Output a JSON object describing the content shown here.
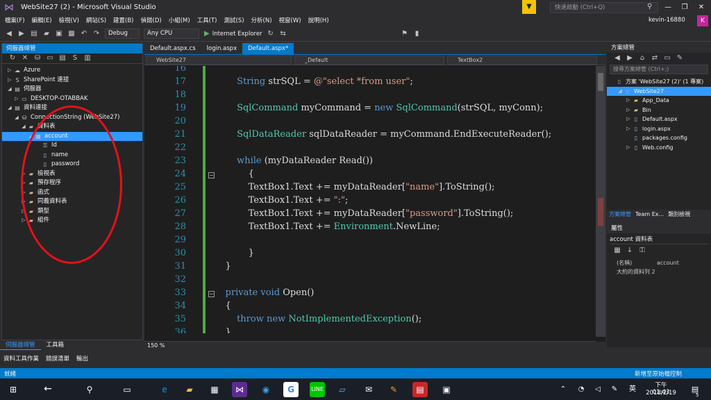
{
  "window": {
    "title": "WebSite27 (2) - Microsoft Visual Studio",
    "quick_launch": "快速啟動 (Ctrl+Q)",
    "user": "kevin-16880",
    "user_initial": "K"
  },
  "menu": [
    "檔案(F)",
    "編輯(E)",
    "檢視(V)",
    "網站(S)",
    "建置(B)",
    "偵錯(D)",
    "小組(M)",
    "工具(T)",
    "測試(S)",
    "分析(N)",
    "視窗(W)",
    "說明(H)"
  ],
  "toolbar": {
    "config": "Debug",
    "platform": "Any CPU",
    "run": "Internet Explorer"
  },
  "server_explorer": {
    "title": "伺服器總管",
    "items": [
      {
        "label": "Azure",
        "indent": 1,
        "arrow": "▷",
        "icon": "☁"
      },
      {
        "label": "SharePoint 連接",
        "indent": 1,
        "arrow": "▷",
        "icon": "S"
      },
      {
        "label": "伺服器",
        "indent": 1,
        "arrow": "◢",
        "icon": "▤"
      },
      {
        "label": "DESKTOP-OTABBAK",
        "indent": 2,
        "arrow": "▷",
        "icon": "▭"
      },
      {
        "label": "資料連接",
        "indent": 1,
        "arrow": "◢",
        "icon": "▤"
      },
      {
        "label": "ConnectionString (WebSite27)",
        "indent": 2,
        "arrow": "◢",
        "icon": "⛁"
      },
      {
        "label": "資料表",
        "indent": 3,
        "arrow": "◢",
        "icon": "▰"
      },
      {
        "label": "account",
        "indent": 4,
        "arrow": "◢",
        "icon": "▦",
        "selected": true
      },
      {
        "label": "Id",
        "indent": 5,
        "arrow": "",
        "icon": "⚿"
      },
      {
        "label": "name",
        "indent": 5,
        "arrow": "",
        "icon": "▯"
      },
      {
        "label": "password",
        "indent": 5,
        "arrow": "",
        "icon": "▯"
      },
      {
        "label": "檢視表",
        "indent": 3,
        "arrow": "▷",
        "icon": "▰"
      },
      {
        "label": "預存程序",
        "indent": 3,
        "arrow": "▷",
        "icon": "▰"
      },
      {
        "label": "函式",
        "indent": 3,
        "arrow": "▷",
        "icon": "▰"
      },
      {
        "label": "同義資料表",
        "indent": 3,
        "arrow": "▷",
        "icon": "▰"
      },
      {
        "label": "類型",
        "indent": 3,
        "arrow": "▷",
        "icon": "▰"
      },
      {
        "label": "組件",
        "indent": 3,
        "arrow": "▷",
        "icon": "▰"
      }
    ],
    "tab_a": "伺服器總管",
    "tab_b": "工具箱"
  },
  "bottom_tabs": [
    "資料工具作業",
    "錯誤清單",
    "輸出"
  ],
  "editor": {
    "tabs": [
      "Default.aspx.cs",
      "login.aspx",
      "Default.aspx*"
    ],
    "nav": [
      "WebSite27",
      "_Default",
      "TextBox2"
    ],
    "zoom": "150 %",
    "lines": [
      {
        "n": "16",
        "code": ""
      },
      {
        "n": "17",
        "code": "        String strSQL = @\"select *from user\";"
      },
      {
        "n": "18",
        "code": ""
      },
      {
        "n": "19",
        "code": "        SqlCommand myCommand = new SqlCommand(strSQL, myConn);"
      },
      {
        "n": "20",
        "code": ""
      },
      {
        "n": "21",
        "code": "        SqlDataReader sqlDataReader = myCommand.EndExecuteReader();"
      },
      {
        "n": "22",
        "code": ""
      },
      {
        "n": "23",
        "code": "        while (myDataReader Read())"
      },
      {
        "n": "24",
        "code": "            {"
      },
      {
        "n": "25",
        "code": "            TextBox1.Text += myDataReader[\"name\"].ToString();"
      },
      {
        "n": "26",
        "code": "            TextBox1.Text += \":\";"
      },
      {
        "n": "27",
        "code": "            TextBox1.Text += myDataReader[\"password\"].ToString();"
      },
      {
        "n": "28",
        "code": "            TextBox1.Text += Environment.NewLine;"
      },
      {
        "n": "29",
        "code": ""
      },
      {
        "n": "30",
        "code": "            }"
      },
      {
        "n": "31",
        "code": "    }"
      },
      {
        "n": "32",
        "code": ""
      },
      {
        "n": "33",
        "code": "    private void Open()"
      },
      {
        "n": "34",
        "code": "    {"
      },
      {
        "n": "35",
        "code": "        throw new NotImplementedException();"
      },
      {
        "n": "36",
        "code": "    }"
      }
    ]
  },
  "solution": {
    "title": "方案總管",
    "search": "搜尋方案總管 (Ctrl+;)",
    "items": [
      {
        "label": "方案 'WebSite27 (2)' (1 專案)",
        "indent": 0,
        "arrow": ""
      },
      {
        "label": "WebSite27",
        "indent": 1,
        "arrow": "◢",
        "selected": true
      },
      {
        "label": "App_Data",
        "indent": 2,
        "arrow": "▷"
      },
      {
        "label": "Bin",
        "indent": 2,
        "arrow": "▷"
      },
      {
        "label": "Default.aspx",
        "indent": 2,
        "arrow": "▷"
      },
      {
        "label": "login.aspx",
        "indent": 2,
        "arrow": "▷"
      },
      {
        "label": "packages.config",
        "indent": 2,
        "arrow": ""
      },
      {
        "label": "Web.config",
        "indent": 2,
        "arrow": "▷"
      }
    ],
    "tabs": [
      "方案總管",
      "Team Ex...",
      "類別檢視"
    ]
  },
  "properties": {
    "title": "屬性",
    "object": "account 資料表",
    "rows": [
      {
        "k": "(名稱)",
        "v": "account"
      },
      {
        "k": "大約的資料列 2",
        "v": ""
      }
    ]
  },
  "status": {
    "left": "就緒",
    "right": "新增至原始檔控制"
  },
  "taskbar": {
    "time": "下午 01:43",
    "date": "2018/2/19",
    "ime": "英",
    "notif": "5"
  }
}
